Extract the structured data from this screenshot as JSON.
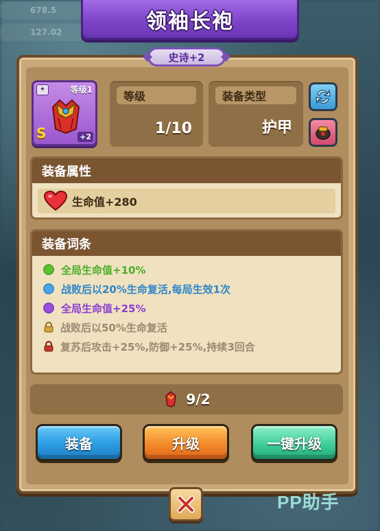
{
  "title": "领袖长袍",
  "rarity_label": "史诗+2",
  "item": {
    "level_label": "等级1",
    "grade": "S",
    "plus": "+2"
  },
  "stats": {
    "level_label": "等级",
    "level_value": "1/10",
    "type_label": "装备类型",
    "type_value": "护甲"
  },
  "attributes": {
    "header": "装备属性",
    "hp_text": "生命值+280"
  },
  "affixes": {
    "header": "装备词条",
    "items": [
      {
        "text": "全局生命值+10%",
        "color": "#4cae2a",
        "dot": "#5dc232",
        "locked": false
      },
      {
        "text": "战败后以20%生命复活,每局生效1次",
        "color": "#2e86c9",
        "dot": "#4aa6e6",
        "locked": false
      },
      {
        "text": "全局生命值+25%",
        "color": "#8a3fd1",
        "dot": "#9a4fe0",
        "locked": false
      },
      {
        "text": "战败后以50%生命复活",
        "color": "#9a8a72",
        "dot": "#d6a43a",
        "locked": true
      },
      {
        "text": "复苏后攻击+25%,防御+25%,持续3回合",
        "color": "#9a8a72",
        "dot": "#c23a2a",
        "locked": true
      }
    ]
  },
  "cost": {
    "value": "9/2"
  },
  "buttons": {
    "equip": "装备",
    "upgrade": "升级",
    "one_click_upgrade": "一键升级"
  },
  "watermark": "PP助手",
  "background": {
    "text_1": "678.5",
    "text_2": "127.02"
  },
  "colors": {
    "banner_purple": "#7d46c9",
    "panel_brown": "#c9a979",
    "equip_blue": "#2e9fe6",
    "upgrade_orange": "#f28a2a",
    "one_click_green": "#3fcf9a"
  }
}
